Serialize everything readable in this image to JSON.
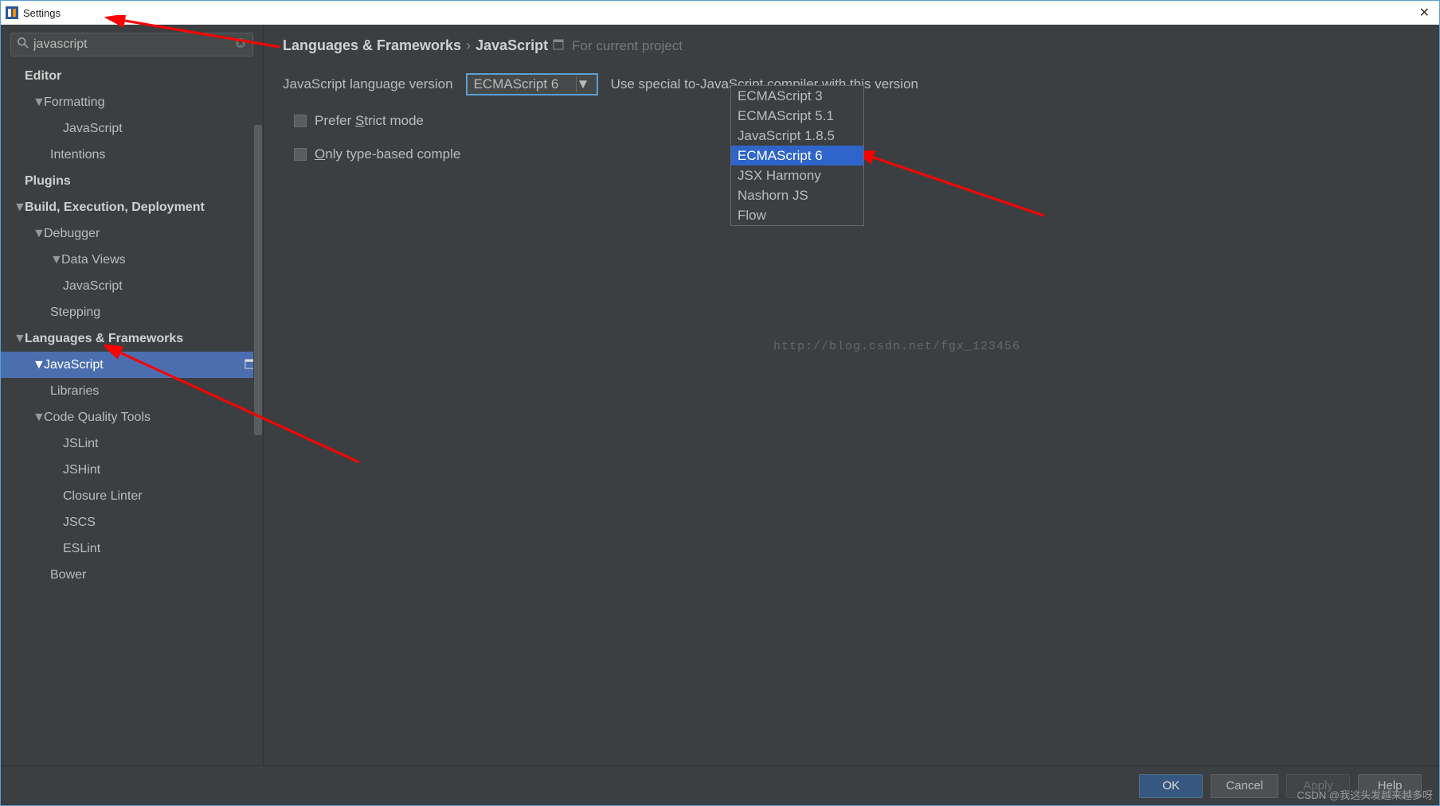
{
  "window": {
    "title": "Settings"
  },
  "search": {
    "value": "javascript",
    "placeholder": ""
  },
  "sidebar": {
    "items": [
      {
        "label": "Editor",
        "bold": true
      },
      {
        "label": "Formatting",
        "chev": true,
        "indent": 1
      },
      {
        "label": "JavaScript",
        "indent": 3
      },
      {
        "label": "Intentions",
        "indent": 2
      },
      {
        "label": "Plugins",
        "bold": true
      },
      {
        "label": "Build, Execution, Deployment",
        "bold": true,
        "chev": true
      },
      {
        "label": "Debugger",
        "chev": true,
        "indent": 1
      },
      {
        "label": "Data Views",
        "chev": true,
        "indent": 2
      },
      {
        "label": "JavaScript",
        "indent": 3
      },
      {
        "label": "Stepping",
        "indent": 2
      },
      {
        "label": "Languages & Frameworks",
        "bold": true,
        "chev": true
      },
      {
        "label": "JavaScript",
        "chev": true,
        "indent": 1,
        "selected": true,
        "project_icon": true
      },
      {
        "label": "Libraries",
        "indent": 2
      },
      {
        "label": "Code Quality Tools",
        "chev": true,
        "indent": 1
      },
      {
        "label": "JSLint",
        "indent": 3
      },
      {
        "label": "JSHint",
        "indent": 3
      },
      {
        "label": "Closure Linter",
        "indent": 3
      },
      {
        "label": "JSCS",
        "indent": 3
      },
      {
        "label": "ESLint",
        "indent": 3
      },
      {
        "label": "Bower",
        "indent": 2
      }
    ]
  },
  "breadcrumb": {
    "part1": "Languages & Frameworks",
    "part2": "JavaScript",
    "note": "For current project"
  },
  "main": {
    "versionLabel": "JavaScript language version",
    "versionValue": "ECMAScript 6",
    "hint": "Use special to-JavaScript compiler with this version",
    "preferStrict_pre": "Prefer ",
    "preferStrict_u": "S",
    "preferStrict_post": "trict mode",
    "onlyTyped_pre": "",
    "onlyTyped_u": "O",
    "onlyTyped_post": "nly type-based comple"
  },
  "dropdown": {
    "options": [
      "ECMAScript 3",
      "ECMAScript 5.1",
      "JavaScript 1.8.5",
      "ECMAScript 6",
      "JSX Harmony",
      "Nashorn JS",
      "Flow"
    ],
    "highlightIndex": 3
  },
  "watermark": "http://blog.csdn.net/fgx_123456",
  "buttons": {
    "ok": "OK",
    "cancel": "Cancel",
    "apply": "Apply",
    "help": "Help"
  },
  "csdn": "CSDN @我这头发越来越多呀"
}
